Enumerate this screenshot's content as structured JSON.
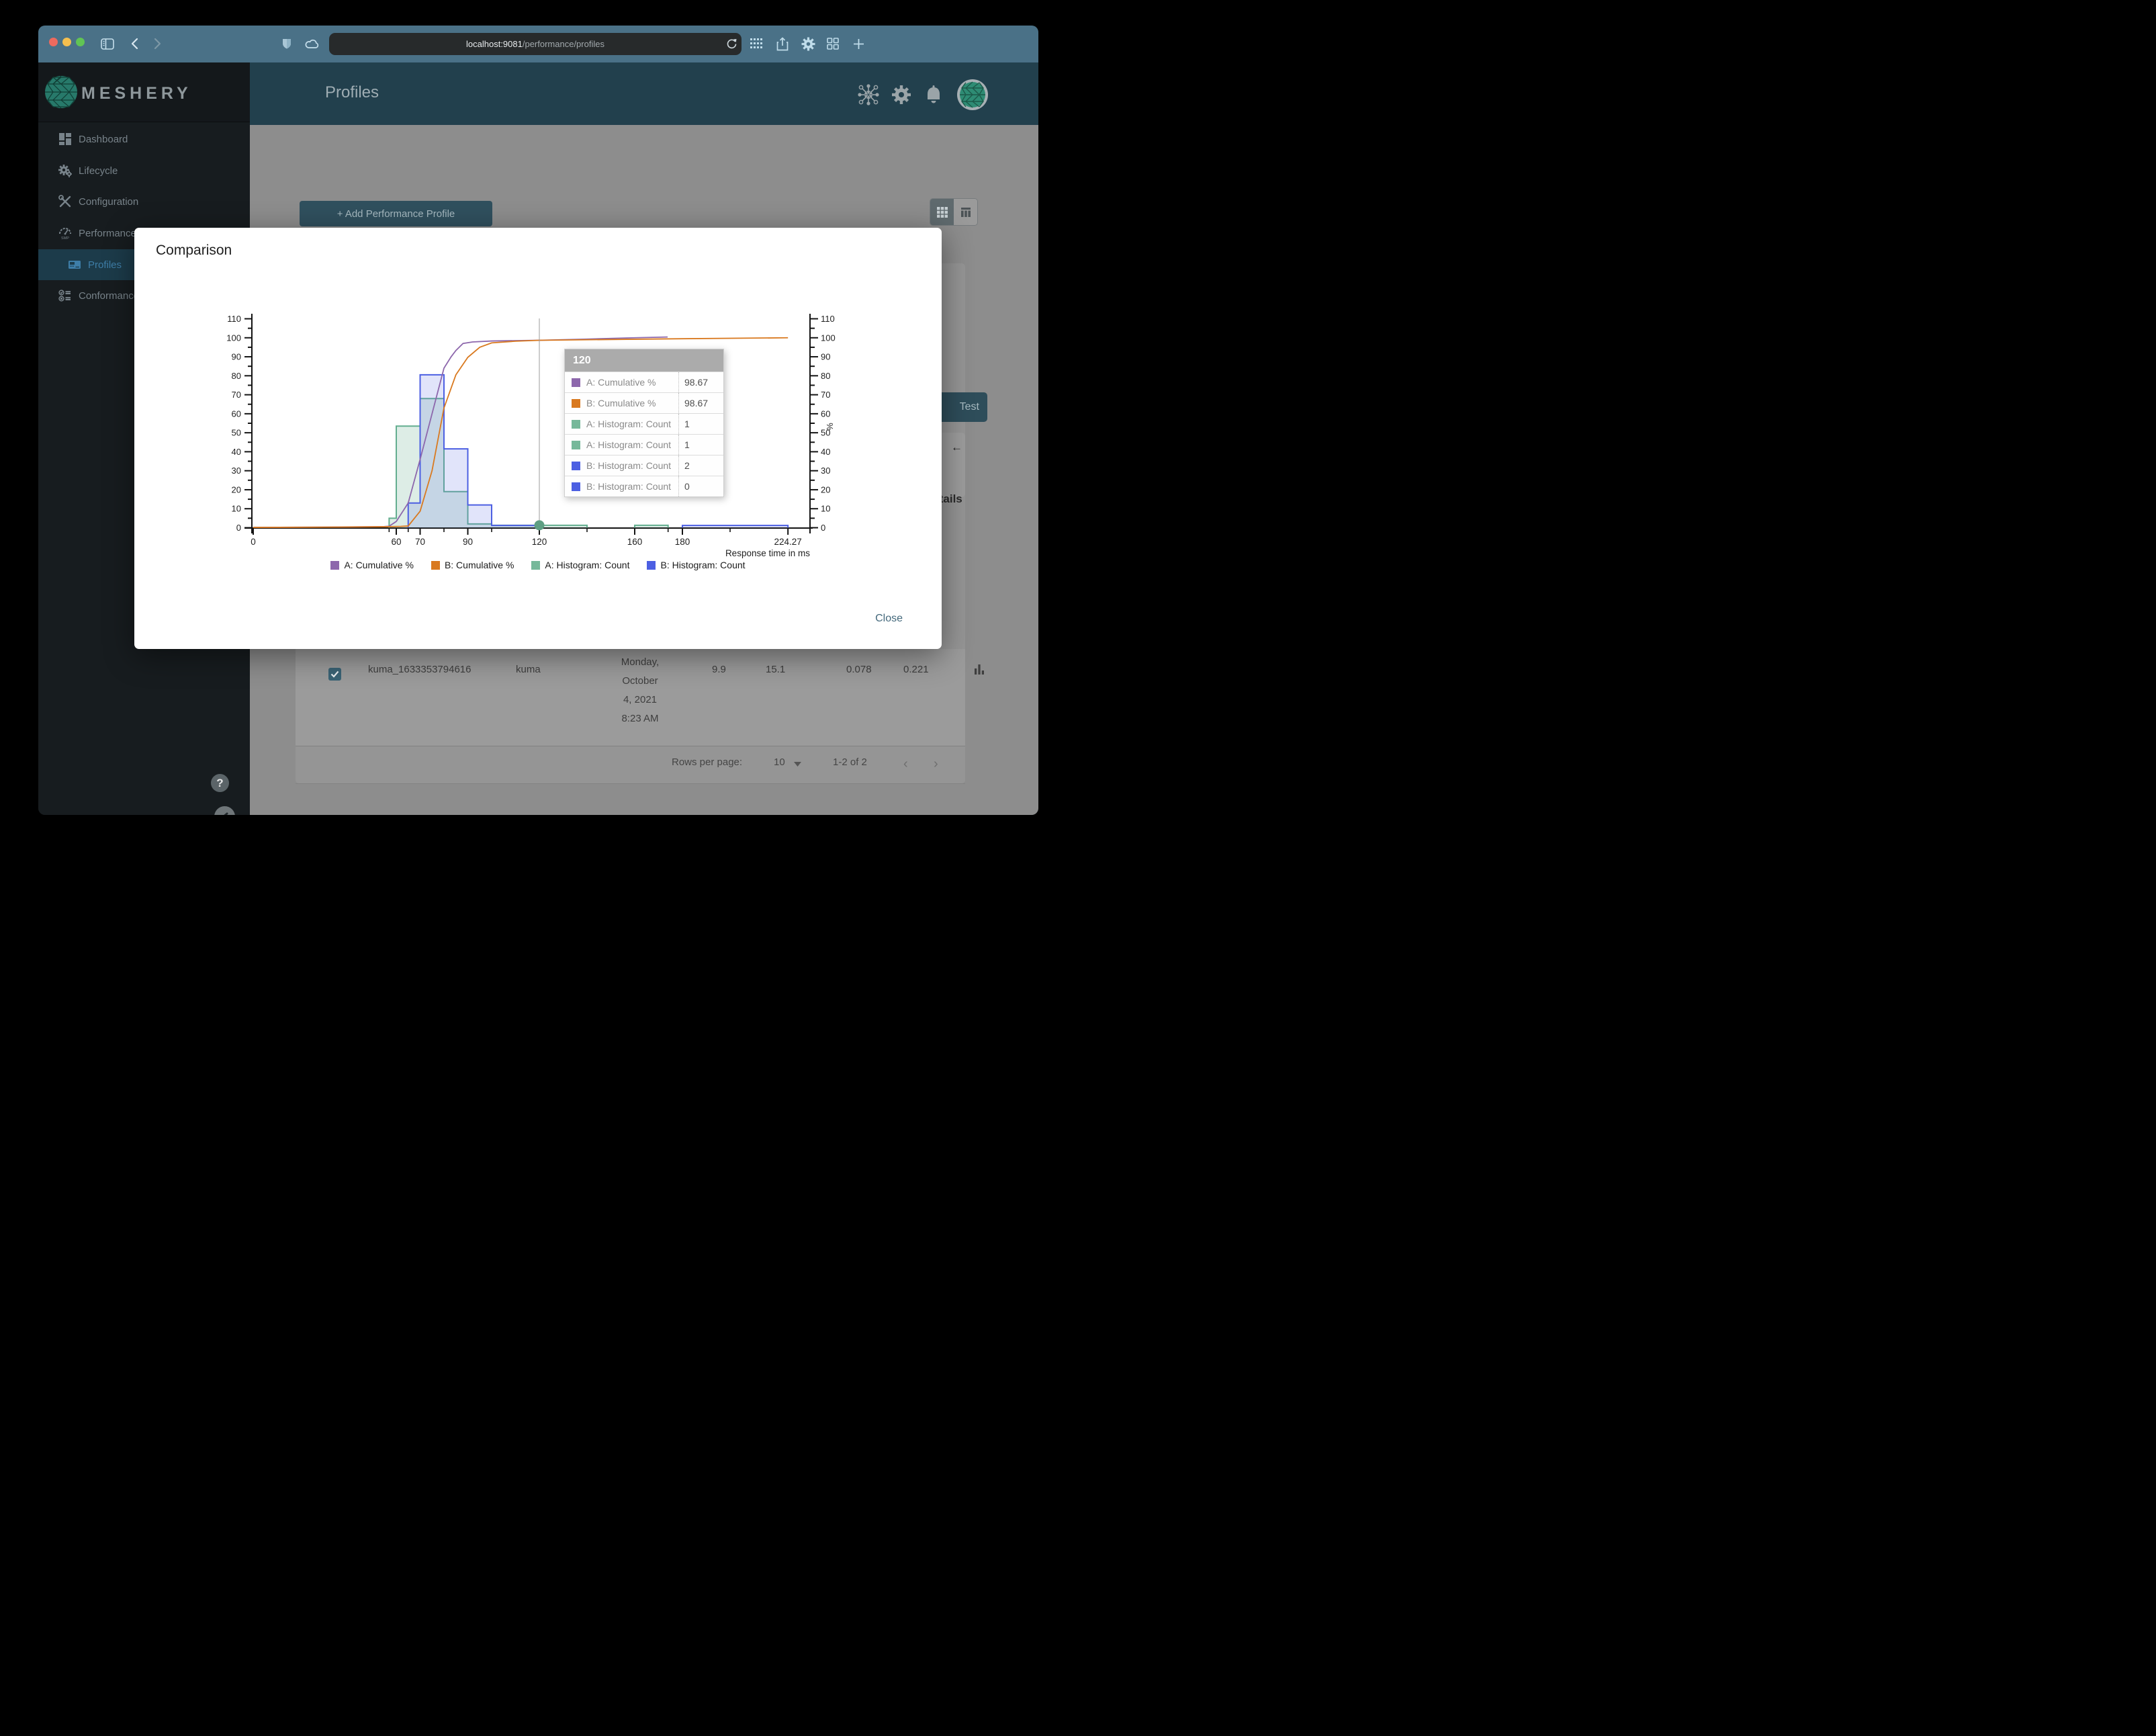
{
  "browser": {
    "url": {
      "host": "localhost:9081",
      "path": "/performance/profiles"
    },
    "traffic_lights": {
      "close": "#ed6a5e",
      "minimize": "#f4bf4f",
      "zoom": "#61c454"
    }
  },
  "sidebar": {
    "brand": "MESHERY",
    "items": [
      {
        "label": "Dashboard",
        "icon": "dashboard-icon",
        "selected": false
      },
      {
        "label": "Lifecycle",
        "icon": "gears-icon",
        "selected": false
      },
      {
        "label": "Configuration",
        "icon": "tools-icon",
        "selected": false
      },
      {
        "label": "Performance",
        "icon": "speedometer-smp-icon",
        "selected": false
      },
      {
        "label": "Profiles",
        "icon": "profile-board-icon",
        "selected": true
      },
      {
        "label": "Conformance",
        "icon": "checklist-icon",
        "selected": false
      }
    ]
  },
  "header": {
    "title": "Profiles"
  },
  "content": {
    "add_profile_button": "+ Add Performance Profile",
    "test_button": "Test",
    "details_heading": "Details",
    "row": {
      "name": "kuma_1633353794616",
      "mesh": "kuma",
      "date_lines": [
        "Monday,",
        "October",
        "4, 2021",
        "8:23 AM"
      ],
      "values": [
        "9.9",
        "15.1",
        "0.078",
        "0.221"
      ]
    },
    "pagination": {
      "label": "Rows per page:",
      "value": "10",
      "range": "1-2 of 2"
    }
  },
  "modal": {
    "title": "Comparison",
    "close_label": "Close",
    "tooltip": {
      "header": "120",
      "rows": [
        {
          "color": "#8d67ac",
          "label": "A: Cumulative %",
          "value": "98.67"
        },
        {
          "color": "#d9791f",
          "label": "B: Cumulative %",
          "value": "98.67"
        },
        {
          "color": "#76b89a",
          "label": "A: Histogram: Count",
          "value": "1"
        },
        {
          "color": "#76b89a",
          "label": "A: Histogram: Count",
          "value": "1"
        },
        {
          "color": "#4c5fe2",
          "label": "B: Histogram: Count",
          "value": "2"
        },
        {
          "color": "#4c5fe2",
          "label": "B: Histogram: Count",
          "value": "0"
        }
      ]
    }
  },
  "chart_data": {
    "type": "line",
    "title": "",
    "xlabel": "Response time in ms",
    "ylabel_right": "%",
    "xlim": [
      0,
      234
    ],
    "ylim": [
      0,
      110
    ],
    "y_major_step": 10,
    "y_minor_step": 5,
    "grid": false,
    "legend_position": "bottom",
    "x_ticks": {
      "labeled": [
        {
          "v": 0,
          "label": "0"
        },
        {
          "v": 60,
          "label": "60"
        },
        {
          "v": 70,
          "label": "70"
        },
        {
          "v": 90,
          "label": "90"
        },
        {
          "v": 120,
          "label": "120"
        },
        {
          "v": 160,
          "label": "160"
        },
        {
          "v": 180,
          "label": "180"
        },
        {
          "v": 224.27,
          "label": "224.27"
        }
      ],
      "minor": [
        57,
        65,
        80,
        100,
        140,
        174,
        200
      ]
    },
    "series": [
      {
        "name": "A: Cumulative %",
        "type": "line",
        "color": "#8d67ac",
        "points": [
          [
            0,
            0.15
          ],
          [
            30,
            0.3
          ],
          [
            50,
            0.5
          ],
          [
            55,
            0.6
          ],
          [
            57,
            0.8
          ],
          [
            60,
            3.3
          ],
          [
            65,
            13
          ],
          [
            70,
            36
          ],
          [
            75,
            60
          ],
          [
            80,
            84
          ],
          [
            83,
            90
          ],
          [
            85,
            93.3
          ],
          [
            88,
            97
          ],
          [
            92,
            97.8
          ],
          [
            100,
            98.3
          ],
          [
            110,
            98.5
          ],
          [
            120,
            98.67
          ],
          [
            140,
            99.3
          ],
          [
            160,
            100
          ],
          [
            173.8,
            100.4
          ]
        ]
      },
      {
        "name": "B: Cumulative %",
        "type": "line",
        "color": "#d9791f",
        "points": [
          [
            0,
            0.15
          ],
          [
            30,
            0.3
          ],
          [
            55,
            0.5
          ],
          [
            62,
            0.7
          ],
          [
            65,
            0.9
          ],
          [
            70,
            8.7
          ],
          [
            75,
            30
          ],
          [
            80,
            63
          ],
          [
            85,
            80.5
          ],
          [
            90,
            89.7
          ],
          [
            95,
            95
          ],
          [
            100,
            97.3
          ],
          [
            110,
            98.2
          ],
          [
            120,
            98.67
          ],
          [
            150,
            99.1
          ],
          [
            180,
            99.5
          ],
          [
            224.27,
            100
          ]
        ]
      },
      {
        "name": "A: Histogram: Count",
        "type": "histogram",
        "color": "#63ae8f",
        "fill": "rgba(118,184,154,0.25)",
        "bins": [
          [
            57,
            60,
            5
          ],
          [
            60,
            70,
            53.5
          ],
          [
            70,
            80,
            68
          ],
          [
            80,
            90,
            19
          ],
          [
            90,
            100,
            2
          ],
          [
            100,
            140,
            1.3
          ],
          [
            160,
            174,
            1.3
          ]
        ]
      },
      {
        "name": "B: Histogram: Count",
        "type": "histogram",
        "color": "#4c5fe2",
        "fill": "rgba(90,105,230,0.18)",
        "bins": [
          [
            65,
            70,
            13
          ],
          [
            70,
            80,
            80.5
          ],
          [
            80,
            90,
            41.5
          ],
          [
            90,
            100,
            12
          ],
          [
            100,
            120,
            1.2
          ],
          [
            180,
            224.27,
            1.2
          ]
        ]
      }
    ],
    "hover": {
      "x": 120,
      "dots": [
        {
          "y": 1.2,
          "color": "#4c5fe2",
          "r": 4
        },
        {
          "y": 1.3,
          "color": "#5e9f83",
          "r": 7.5
        }
      ]
    }
  }
}
